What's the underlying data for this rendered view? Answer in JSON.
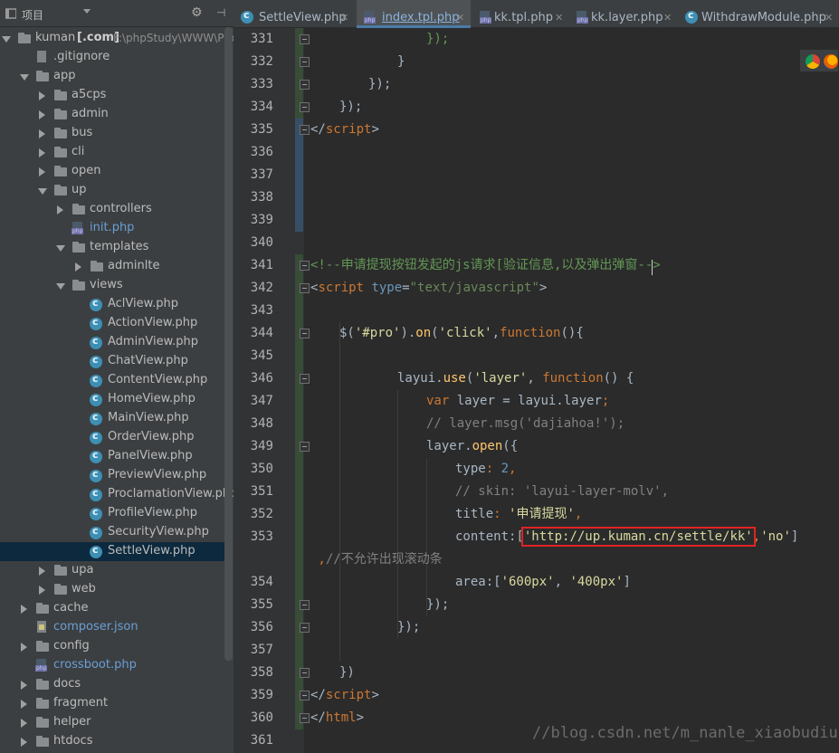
{
  "sidebar": {
    "title": "项目",
    "tree": [
      {
        "name": "kuman",
        "suffix": "[.com]",
        "path": "F:\\phpStudy\\WWW\\Pro",
        "type": "root",
        "depth": 0,
        "arrow": "open"
      },
      {
        "name": ".gitignore",
        "type": "file",
        "depth": 1,
        "arrow": "none"
      },
      {
        "name": "app",
        "type": "folder",
        "depth": 1,
        "arrow": "open"
      },
      {
        "name": "a5cps",
        "type": "folder",
        "depth": 2,
        "arrow": "closed"
      },
      {
        "name": "admin",
        "type": "folder",
        "depth": 2,
        "arrow": "closed"
      },
      {
        "name": "bus",
        "type": "folder",
        "depth": 2,
        "arrow": "closed"
      },
      {
        "name": "cli",
        "type": "folder",
        "depth": 2,
        "arrow": "closed"
      },
      {
        "name": "open",
        "type": "folder",
        "depth": 2,
        "arrow": "closed"
      },
      {
        "name": "up",
        "type": "folder",
        "depth": 2,
        "arrow": "open"
      },
      {
        "name": "controllers",
        "type": "folder",
        "depth": 3,
        "arrow": "closed"
      },
      {
        "name": "init.php",
        "type": "php",
        "depth": 3,
        "arrow": "none"
      },
      {
        "name": "templates",
        "type": "folder",
        "depth": 3,
        "arrow": "open"
      },
      {
        "name": "adminlte",
        "type": "folder",
        "depth": 4,
        "arrow": "closed"
      },
      {
        "name": "views",
        "type": "folder",
        "depth": 3,
        "arrow": "open"
      },
      {
        "name": "AclView.php",
        "type": "class",
        "depth": 4,
        "arrow": "none"
      },
      {
        "name": "ActionView.php",
        "type": "class",
        "depth": 4,
        "arrow": "none"
      },
      {
        "name": "AdminView.php",
        "type": "class",
        "depth": 4,
        "arrow": "none"
      },
      {
        "name": "ChatView.php",
        "type": "class",
        "depth": 4,
        "arrow": "none"
      },
      {
        "name": "ContentView.php",
        "type": "class",
        "depth": 4,
        "arrow": "none"
      },
      {
        "name": "HomeView.php",
        "type": "class",
        "depth": 4,
        "arrow": "none"
      },
      {
        "name": "MainView.php",
        "type": "class",
        "depth": 4,
        "arrow": "none"
      },
      {
        "name": "OrderView.php",
        "type": "class",
        "depth": 4,
        "arrow": "none"
      },
      {
        "name": "PanelView.php",
        "type": "class",
        "depth": 4,
        "arrow": "none"
      },
      {
        "name": "PreviewView.php",
        "type": "class",
        "depth": 4,
        "arrow": "none"
      },
      {
        "name": "ProclamationView.php",
        "type": "class",
        "depth": 4,
        "arrow": "none"
      },
      {
        "name": "ProfileView.php",
        "type": "class",
        "depth": 4,
        "arrow": "none"
      },
      {
        "name": "SecurityView.php",
        "type": "class",
        "depth": 4,
        "arrow": "none"
      },
      {
        "name": "SettleView.php",
        "type": "class",
        "depth": 4,
        "arrow": "none",
        "selected": true
      },
      {
        "name": "upa",
        "type": "folder",
        "depth": 2,
        "arrow": "closed"
      },
      {
        "name": "web",
        "type": "folder",
        "depth": 2,
        "arrow": "closed"
      },
      {
        "name": "cache",
        "type": "folder",
        "depth": 1,
        "arrow": "closed"
      },
      {
        "name": "composer.json",
        "type": "json",
        "depth": 1,
        "arrow": "none"
      },
      {
        "name": "config",
        "type": "folder",
        "depth": 1,
        "arrow": "closed"
      },
      {
        "name": "crossboot.php",
        "type": "php",
        "depth": 1,
        "arrow": "none"
      },
      {
        "name": "docs",
        "type": "folder",
        "depth": 1,
        "arrow": "closed"
      },
      {
        "name": "fragment",
        "type": "folder",
        "depth": 1,
        "arrow": "closed"
      },
      {
        "name": "helper",
        "type": "folder",
        "depth": 1,
        "arrow": "closed"
      },
      {
        "name": "htdocs",
        "type": "folder",
        "depth": 1,
        "arrow": "closed"
      }
    ]
  },
  "tabs": [
    {
      "label": "SettleView.php",
      "icon": "class-icon",
      "active": false
    },
    {
      "label": "index.tpl.php",
      "icon": "php-icon",
      "active": true
    },
    {
      "label": "kk.tpl.php",
      "icon": "php-icon",
      "active": false
    },
    {
      "label": "kk.layer.php",
      "icon": "php-icon",
      "active": false
    },
    {
      "label": "WithdrawModule.php",
      "icon": "class-icon",
      "active": false
    }
  ],
  "close_glyph": "✕",
  "editor": {
    "line_numbers": [
      "331",
      "332",
      "333",
      "334",
      "335",
      "336",
      "337",
      "338",
      "339",
      "340",
      "341",
      "342",
      "343",
      "344",
      "345",
      "346",
      "347",
      "348",
      "349",
      "350",
      "351",
      "352",
      "353",
      "",
      "354",
      "355",
      "356",
      "357",
      "358",
      "359",
      "360",
      "361"
    ],
    "lines": {
      "l331": "});",
      "l332": "}",
      "l333": "});",
      "l334": "});",
      "l335_tag": "script",
      "l341": "<!--申请提现按钮发起的js请求[验证信息,以及弹出弹窗-->",
      "l342_tag": "script",
      "l342_attr": "type",
      "l342_val": "\"text/javascript\"",
      "l344_a": "$(",
      "l344_s1": "'#pro'",
      "l344_b": ").",
      "l344_fn": "on",
      "l344_c": "(",
      "l344_s2": "'click'",
      "l344_d": ",",
      "l344_kw": "function",
      "l344_e": "(){",
      "l346_a": "layui.",
      "l346_fn": "use",
      "l346_b": "(",
      "l346_s": "'layer'",
      "l346_c": ", ",
      "l346_kw": "function",
      "l346_d": "() {",
      "l347_kw": "var",
      "l347_a": " layer = layui.layer",
      "l347_b": ";",
      "l348": "// layer.msg('dajiahoa!');",
      "l349_a": "layer.",
      "l349_fn": "open",
      "l349_b": "({",
      "l350_a": "type",
      "l350_b": ": ",
      "l350_n": "2",
      "l350_c": ",",
      "l351": "// skin: 'layui-layer-molv',",
      "l352_a": "title",
      "l352_b": ": ",
      "l352_s": "'申请提现'",
      "l352_c": ",",
      "l353_a": "content",
      "l353_b": ":[",
      "l353_url": "'http://up.kuman.cn/settle/kk'",
      "l353_c": ",",
      "l353_s": "'no'",
      "l353_d": "]",
      "l353w_a": " ,",
      "l353w_b": "//不允许出现滚动条",
      "l354_a": "area",
      "l354_b": ":[",
      "l354_s1": "'600px'",
      "l354_c": ", ",
      "l354_s2": "'400px'",
      "l354_d": "]",
      "l355": "});",
      "l356": "});",
      "l358": "})",
      "l359_tag": "script",
      "l360_tag": "html"
    },
    "watermark": "//blog.csdn.net/m_nanle_xiaobudiu"
  },
  "colors": {
    "accent": "#4b7ba8",
    "selection": "#0d293e",
    "highlight_box": "#e12323"
  }
}
